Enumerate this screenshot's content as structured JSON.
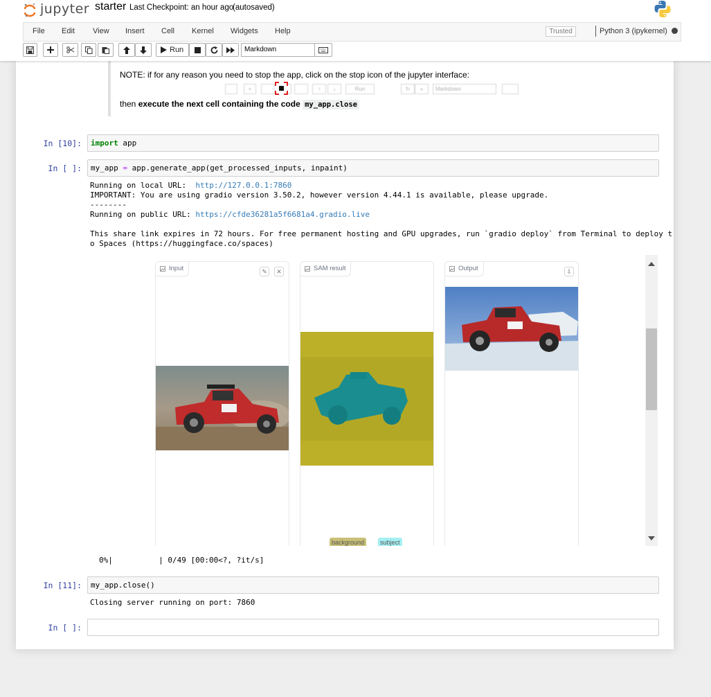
{
  "header": {
    "logo_text": "jupyter",
    "notebook_name": "starter",
    "checkpoint": "Last Checkpoint: an hour ago",
    "autosave": "(autosaved)"
  },
  "menu": {
    "items": [
      "File",
      "Edit",
      "View",
      "Insert",
      "Cell",
      "Kernel",
      "Widgets",
      "Help"
    ],
    "trusted": "Trusted",
    "kernel": "Python 3 (ipykernel)"
  },
  "toolbar": {
    "run_label": "Run",
    "cell_type": "Markdown"
  },
  "markdown_cell": {
    "note": "NOTE: if for any reason you need to stop the app, click on the stop icon of the jupyter interface:",
    "mini_run": "Run",
    "mini_cell_type": "Markdown",
    "then_prefix": "then ",
    "then_bold": "execute the next cell containing the code",
    "code": "my_app.close"
  },
  "cells": [
    {
      "prompt": "In [10]:",
      "keyword": "import",
      "rest": " app"
    },
    {
      "prompt": "In [ ]:",
      "code_left": "my_app ",
      "code_op": "=",
      "code_right": " app.generate_app(get_processed_inputs, inpaint)",
      "output": {
        "local_prefix": "Running on local URL:  ",
        "local_url": "http://127.0.0.1:7860",
        "important": "IMPORTANT: You are using gradio version 3.50.2, however version 4.44.1 is available, please upgrade.",
        "dashes": "--------",
        "public_prefix": "Running on public URL: ",
        "public_url": "https://cfde36281a5f6681a4.gradio.live",
        "share_line1": "This share link expires in 72 hours. For free permanent hosting and GPU upgrades, run `gradio deploy` from Terminal to deploy t",
        "share_line2": "o Spaces (https://huggingface.co/spaces)"
      },
      "gradio": {
        "panels": [
          "Input",
          "SAM result",
          "Output"
        ],
        "tags": [
          "background",
          "subject"
        ]
      },
      "progress": "0%|          | 0/49 [00:00<?, ?it/s]"
    },
    {
      "prompt": "In [11]:",
      "code": "my_app.close()",
      "output": "Closing server running on port: 7860"
    },
    {
      "prompt": "In [ ]:",
      "code": ""
    }
  ]
}
